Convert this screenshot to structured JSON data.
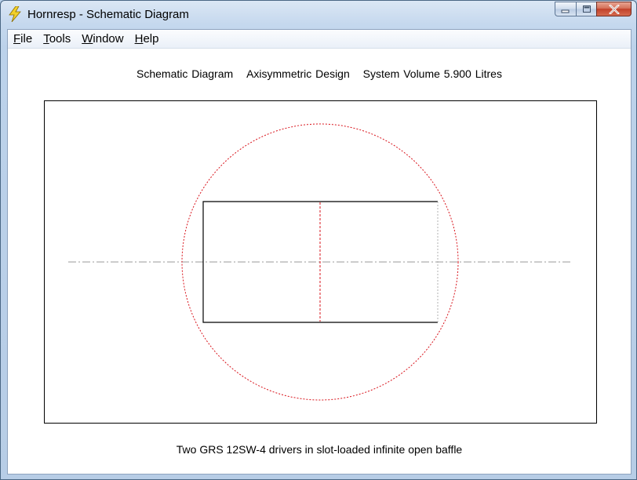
{
  "window": {
    "title": "Hornresp - Schematic Diagram",
    "icon": "lightning-bolt-icon",
    "controls": {
      "minimize": "minimize-icon",
      "maximize": "maximize-icon",
      "close": "close-icon"
    }
  },
  "menu": {
    "items": [
      {
        "label": "File",
        "accel": "F",
        "rest": "ile"
      },
      {
        "label": "Tools",
        "accel": "T",
        "rest": "ools"
      },
      {
        "label": "Window",
        "accel": "W",
        "rest": "indow"
      },
      {
        "label": "Help",
        "accel": "H",
        "rest": "elp"
      }
    ]
  },
  "header": {
    "title": "Schematic Diagram",
    "design": "Axisymmetric Design",
    "volume": "System Volume 5.900 Litres"
  },
  "footer": {
    "description": "Two GRS 12SW-4 drivers in slot-loaded infinite open baffle"
  },
  "colors": {
    "accent_red": "#d9141c",
    "axis_gray": "#9a9a9a",
    "frame": "#000000"
  }
}
